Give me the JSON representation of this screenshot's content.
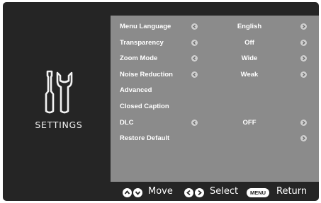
{
  "side": {
    "title": "SETTINGS",
    "icon": "screwdriver-wrench-icon"
  },
  "menu": {
    "items": [
      {
        "label": "Menu Language",
        "value": "English",
        "arrows": true
      },
      {
        "label": "Transparency",
        "value": "Off",
        "arrows": true
      },
      {
        "label": "Zoom Mode",
        "value": "Wide",
        "arrows": true
      },
      {
        "label": "Noise Reduction",
        "value": "Weak",
        "arrows": true
      },
      {
        "label": "Advanced",
        "value": "",
        "arrows": false
      },
      {
        "label": "Closed Caption",
        "value": "",
        "arrows": false
      },
      {
        "label": "DLC",
        "value": "OFF",
        "arrows": true
      },
      {
        "label": "Restore Default",
        "value": "",
        "arrows": "right"
      }
    ]
  },
  "footer": {
    "move_label": "Move",
    "select_label": "Select",
    "menu_key": "MENU",
    "return_label": "Return"
  },
  "colors": {
    "frame": "#252525",
    "panel": "#8b8b8b",
    "text": "#ffffff"
  }
}
